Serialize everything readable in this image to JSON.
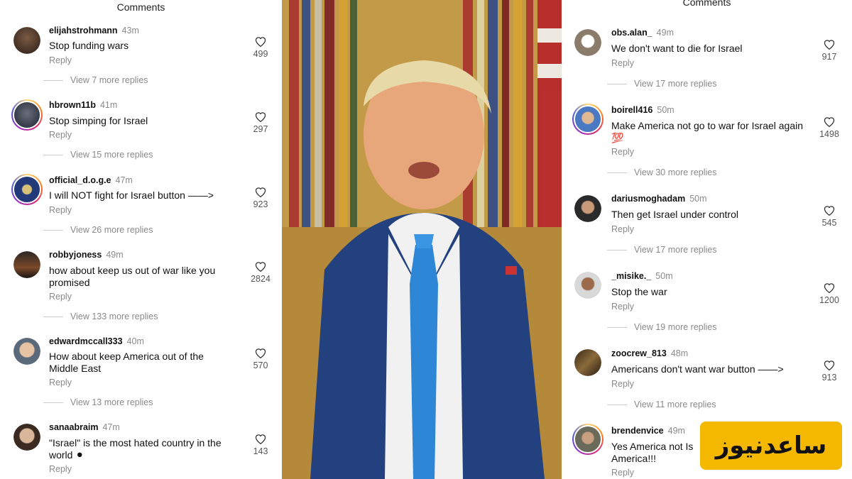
{
  "left": {
    "title": "Comments",
    "comments": [
      {
        "user": "elijahstrohmann",
        "time": "43m",
        "text": "Stop funding wars",
        "reply": "Reply",
        "likes": "499",
        "more": "View 7 more replies"
      },
      {
        "user": "hbrown11b",
        "time": "41m",
        "text": "Stop simping for Israel",
        "reply": "Reply",
        "likes": "297",
        "more": "View 15 more replies"
      },
      {
        "user": "official_d.o.g.e",
        "time": "47m",
        "text": "I will NOT fight for Israel button ——>",
        "reply": "Reply",
        "likes": "923",
        "more": "View 26 more replies"
      },
      {
        "user": "robbyjoness",
        "time": "49m",
        "text": "how about keep us out of war like you promised",
        "reply": "Reply",
        "likes": "2824",
        "more": "View 133 more replies"
      },
      {
        "user": "edwardmccall333",
        "time": "40m",
        "text": "How about keep America out of the Middle East",
        "reply": "Reply",
        "likes": "570",
        "more": "View 13 more replies"
      },
      {
        "user": "sanaabraim",
        "time": "47m",
        "text": "\"Israel\" is the most hated country in the world ⚫",
        "reply": "Reply",
        "likes": "143"
      }
    ]
  },
  "right": {
    "title": "Comments",
    "comments": [
      {
        "user": "obs.alan_",
        "time": "49m",
        "text": "We don't want to die for Israel",
        "reply": "Reply",
        "likes": "917",
        "more": "View 17 more replies"
      },
      {
        "user": "boirell416",
        "time": "50m",
        "text": "Make America not go to war for Israel again 💯",
        "reply": "Reply",
        "likes": "1498",
        "more": "View 30 more replies"
      },
      {
        "user": "dariusmoghadam",
        "time": "50m",
        "text": "Then get Israel under control",
        "reply": "Reply",
        "likes": "545",
        "more": "View 17 more replies"
      },
      {
        "user": "_misike._",
        "time": "50m",
        "text": "Stop the war",
        "reply": "Reply",
        "likes": "1200",
        "more": "View 19 more replies"
      },
      {
        "user": "zoocrew_813",
        "time": "48m",
        "text": "Americans don't want war button ——>",
        "reply": "Reply",
        "likes": "913",
        "more": "View 11 more replies"
      },
      {
        "user": "brendenvice",
        "time": "49m",
        "text": "Yes America not Is America!!!",
        "reply": "Reply"
      }
    ]
  },
  "watermark": "ساعدنیوز",
  "colors": {
    "accent_ring": "#d62976",
    "watermark_bg": "#f5b800",
    "meta_gray": "#8a8a8a"
  },
  "icons": {
    "like": "heart-outline-icon"
  }
}
